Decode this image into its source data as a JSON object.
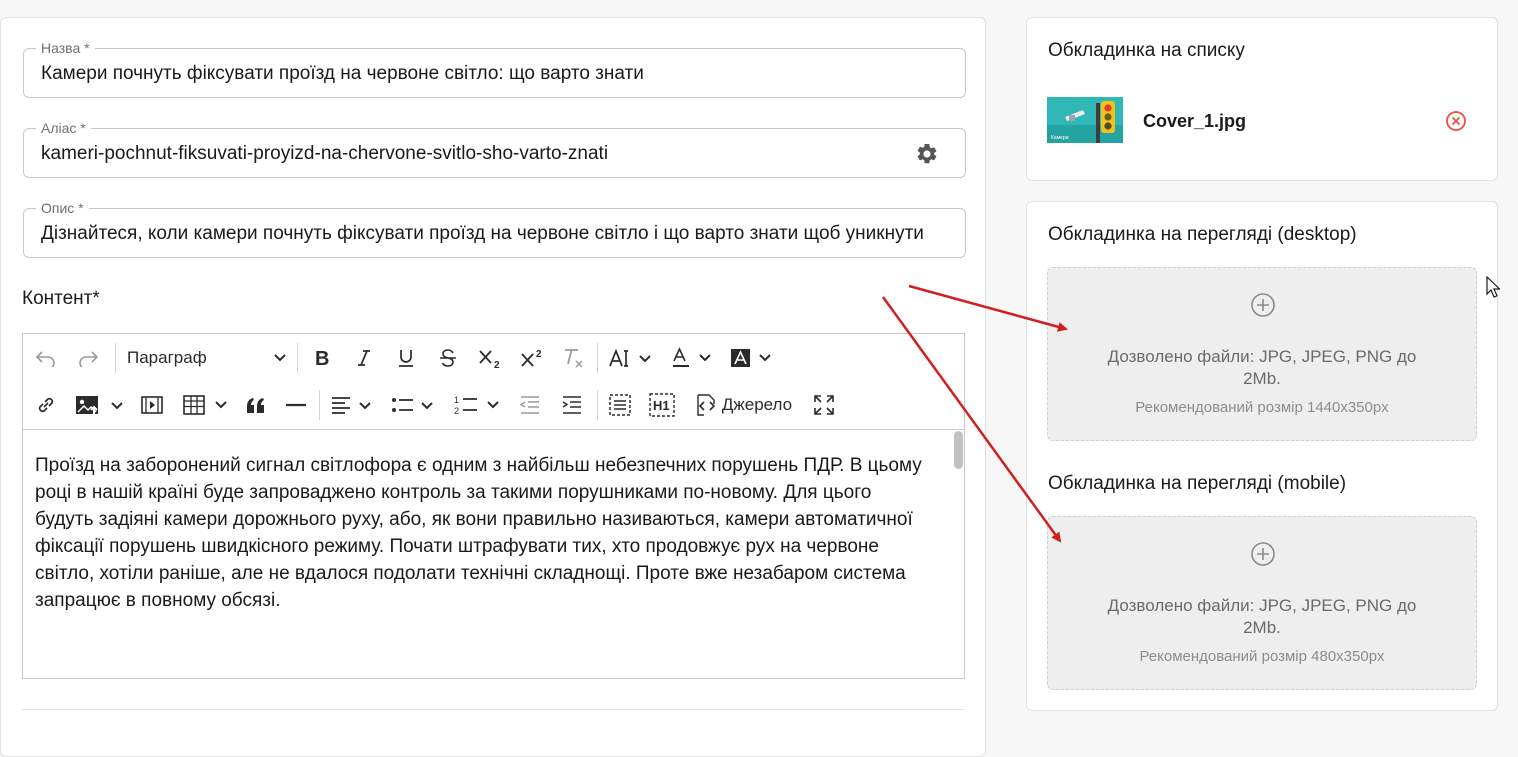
{
  "form": {
    "name": {
      "label": "Назва *",
      "value": "Камери почнуть фіксувати проїзд на червоне світло: що варто знати"
    },
    "alias": {
      "label": "Аліас *",
      "value": "kameri-pochnut-fiksuvati-proyizd-na-chervone-svitlo-sho-varto-znati"
    },
    "description": {
      "label": "Опис *",
      "value": "Дізнайтеся, коли камери почнуть фіксувати проїзд на червоне світло і що варто знати щоб уникнути"
    },
    "content_label": "Контент*"
  },
  "editor": {
    "paragraph_select": "Параграф",
    "source_label": "Джерело",
    "body": "Проїзд на заборонений сигнал світлофора є одним з найбільш небезпечних порушень ПДР. В цьому році в нашій країні буде запроваджено контроль за такими порушниками по-новому. Для цього будуть задіяні камери дорожнього руху, або, як вони правильно називаються, камери автоматичної фіксації порушень швидкісного режиму. Почати штрафувати тих, хто продовжує рух на червоне світло, хотіли раніше, але не вдалося подолати технічні складнощі. Проте вже незабаром система запрацює в повному обсязі."
  },
  "sidebar": {
    "list_cover": {
      "title": "Обкладинка на списку",
      "filename": "Cover_1.jpg",
      "thumb_caption": "Камери"
    },
    "desktop_cover": {
      "title": "Обкладинка на перегляді (desktop)",
      "allowed": "Дозволено файли: JPG, JPEG, PNG до 2Mb.",
      "recommended": "Рекомендований розмір 1440x350px"
    },
    "mobile_cover": {
      "title": "Обкладинка на перегляді (mobile)",
      "allowed": "Дозволено файли: JPG, JPEG, PNG до 2Mb.",
      "recommended": "Рекомендований розмір 480x350px"
    }
  },
  "colors": {
    "arrow": "#d11f1f",
    "remove": "#e8533a",
    "icon": "#2b2b2b"
  }
}
